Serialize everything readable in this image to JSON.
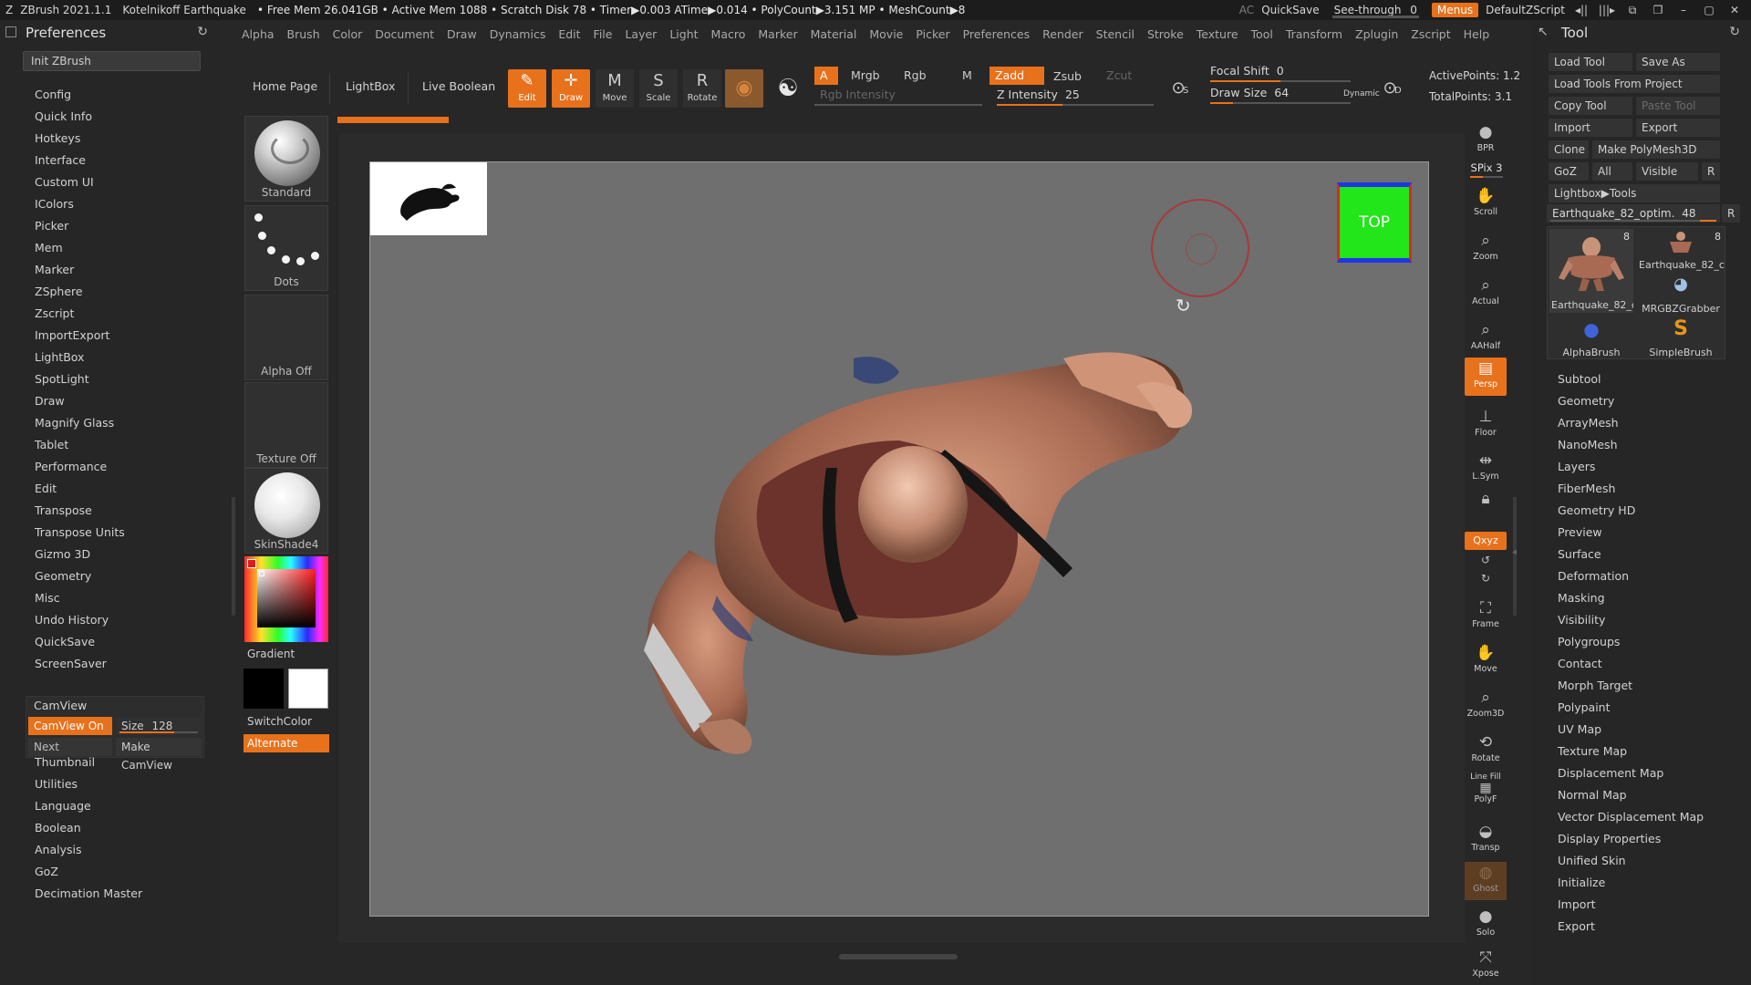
{
  "titlebar": {
    "app": "ZBrush 2021.1.1",
    "project": "Kotelnikoff Earthquake",
    "stats": "• Free Mem 26.041GB • Active Mem 1088 • Scratch Disk 78 • Timer▶0.003 ATime▶0.014 • PolyCount▶3.151 MP • MeshCount▶8",
    "ac": "AC",
    "quicksave": "QuickSave",
    "seethrough": "See-through",
    "seethrough_value": "0",
    "seethrough_level": 0,
    "menus": "Menus",
    "script": "DefaultZScript"
  },
  "menu": [
    "Alpha",
    "Brush",
    "Color",
    "Document",
    "Draw",
    "Dynamics",
    "Edit",
    "File",
    "Layer",
    "Light",
    "Macro",
    "Marker",
    "Material",
    "Movie",
    "Picker",
    "Preferences",
    "Render",
    "Stencil",
    "Stroke",
    "Texture",
    "Tool",
    "Transform",
    "Zplugin",
    "Zscript",
    "Help"
  ],
  "prefs": {
    "title": "Preferences",
    "init": "Init ZBrush",
    "items": [
      "Config",
      "Quick Info",
      "Hotkeys",
      "Interface",
      "Custom UI",
      "IColors",
      "Picker",
      "Mem",
      "Marker",
      "ZSphere",
      "Zscript",
      "ImportExport",
      "LightBox",
      "SpotLight",
      "Draw",
      "Magnify Glass",
      "Tablet",
      "Performance",
      "Edit",
      "Transpose",
      "Transpose Units",
      "Gizmo 3D",
      "Geometry",
      "Misc",
      "Undo History",
      "QuickSave",
      "ScreenSaver"
    ],
    "camview": {
      "title": "CamView",
      "on": "CamView On",
      "size_label": "Size",
      "size_value": "128",
      "next": "Next",
      "make": "Make CamView"
    },
    "items2": [
      "Thumbnail",
      "Utilities",
      "Language",
      "Boolean",
      "Analysis",
      "GoZ",
      "Decimation Master"
    ]
  },
  "brushes": {
    "standard": "Standard",
    "dots": "Dots",
    "alpha": "Alpha Off",
    "texture": "Texture Off",
    "material": "SkinShade4",
    "gradient": "Gradient",
    "switchcolor": "SwitchColor",
    "alternate": "Alternate",
    "colors": {
      "main": "#000000",
      "secondary": "#ffffff"
    }
  },
  "toolbar": {
    "home": "Home Page",
    "lightbox": "LightBox",
    "liveboolean": "Live Boolean",
    "edit": "Edit",
    "draw": "Draw",
    "move": "Move",
    "scale": "Scale",
    "rotate": "Rotate",
    "a": "A",
    "mrgb": "Mrgb",
    "rgb": "Rgb",
    "m": "M",
    "rgb_intensity": "Rgb Intensity",
    "zadd": "Zadd",
    "zsub": "Zsub",
    "zcut": "Zcut",
    "zintensity_label": "Z Intensity",
    "zintensity_value": "25",
    "focal_label": "Focal Shift",
    "focal_value": "0",
    "drawsize_label": "Draw Size",
    "drawsize_value": "64",
    "dynamic": "Dynamic",
    "active_points": "ActivePoints: 1.2",
    "total_points": "TotalPoints: 3.1",
    "s": "S",
    "d": "D"
  },
  "canvas": {
    "nav_cube": "TOP"
  },
  "shelf": {
    "bpr": "BPR",
    "spix": "SPix 3",
    "scroll": "Scroll",
    "zoom": "Zoom",
    "actual": "Actual",
    "aahalf": "AAHalf",
    "persp": "Persp",
    "floor": "Floor",
    "lsym": "L.Sym",
    "xyz": "Qxyz",
    "frame": "Frame",
    "move": "Move",
    "zoom3d": "Zoom3D",
    "rotate": "Rotate",
    "linefill": "Line Fill",
    "polyf": "PolyF",
    "transp": "Transp",
    "ghost": "Ghost",
    "solo": "Solo",
    "xpose": "Xpose"
  },
  "tool": {
    "title": "Tool",
    "load": "Load Tool",
    "saveas": "Save As",
    "loadfromproject": "Load Tools From Project",
    "copy": "Copy Tool",
    "paste": "Paste Tool",
    "import": "Import",
    "export": "Export",
    "clone": "Clone",
    "makepoly": "Make PolyMesh3D",
    "goz": "GoZ",
    "all": "All",
    "visible": "Visible",
    "r": "R",
    "lightbox_tools": "Lightbox▶Tools",
    "current_name": "Earthquake_82_optim.",
    "current_value": "48",
    "grid": [
      {
        "name": "Earthquake_82_c",
        "count": "8"
      },
      {
        "name": "Earthquake_82_c",
        "count": "8"
      },
      {
        "name": "MRGBZGrabber",
        "count": ""
      },
      {
        "name": "AlphaBrush",
        "count": ""
      },
      {
        "name": "SimpleBrush",
        "count": ""
      }
    ],
    "items": [
      "Subtool",
      "Geometry",
      "ArrayMesh",
      "NanoMesh",
      "Layers",
      "FiberMesh",
      "Geometry HD",
      "Preview",
      "Surface",
      "Deformation",
      "Masking",
      "Visibility",
      "Polygroups",
      "Contact",
      "Morph Target",
      "Polypaint",
      "UV Map",
      "Texture Map",
      "Displacement Map",
      "Normal Map",
      "Vector Displacement Map",
      "Display Properties",
      "Unified Skin",
      "Initialize",
      "Import",
      "Export"
    ]
  }
}
